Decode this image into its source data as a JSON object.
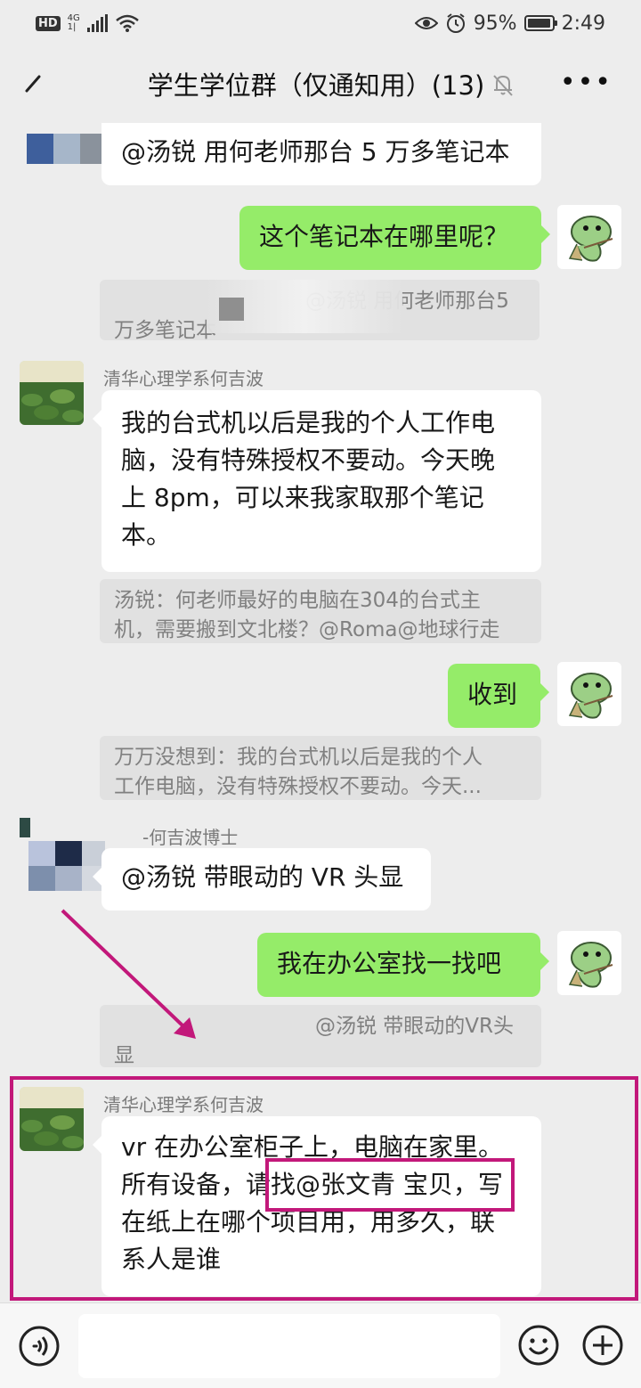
{
  "status_bar": {
    "hd": "HD",
    "network": "4G",
    "network_sub": "1|",
    "battery_pct_text": "95%",
    "battery_level": 0.95,
    "time": "2:49"
  },
  "header": {
    "back_icon": "back-arrow-icon",
    "title": "学生学位群（仅通知用）(13)",
    "mute_icon": "bell-muted-icon",
    "more_icon": "more-dots-icon"
  },
  "messages": [
    {
      "dir": "in",
      "text": "@汤锐 用何老师那台 5 万多笔记本"
    },
    {
      "dir": "out",
      "text": "这个笔记本在哪里呢？"
    },
    {
      "quote": "@汤锐 用何老师那台5万多笔记本",
      "quote_l1": "@汤锐 用何老师那台5",
      "quote_l2": "万多笔记本"
    },
    {
      "dir": "in",
      "sender": "清华心理学系何吉波",
      "lines": [
        "我的台式机以后是我的个人工作电",
        "脑，没有特殊授权不要动。今天晚",
        "上 8pm，可以来我家取那个笔记",
        "本。"
      ]
    },
    {
      "quote_l1": "汤锐：何老师最好的电脑在304的台式主",
      "quote_l2": "机，需要搬到文北楼？@Roma@地球行走"
    },
    {
      "dir": "out",
      "text": "收到"
    },
    {
      "quote_l1": "万万没想到：我的台式机以后是我的个人",
      "quote_l2": "工作电脑，没有特殊授权不要动。今天..."
    },
    {
      "dir": "in",
      "sender": "-何吉波博士",
      "text": "@汤锐 带眼动的 VR 头显"
    },
    {
      "dir": "out",
      "text": "我在办公室找一找吧"
    },
    {
      "quote_l1": "@汤锐 带眼动的VR头",
      "quote_l2": "显"
    },
    {
      "dir": "in",
      "sender": "清华心理学系何吉波",
      "lines": [
        "vr 在办公室柜子上，电脑在家里。",
        "所有设备，请找@张文青 宝贝，写",
        "在纸上在哪个项目用，用多久，联",
        "系人是谁"
      ]
    }
  ],
  "input_bar": {
    "voice_icon": "voice-icon",
    "emoji_icon": "emoji-icon",
    "plus_icon": "plus-icon"
  },
  "colors": {
    "background": "#ededed",
    "bubble_out": "#95ec69",
    "bubble_in": "#ffffff",
    "annotation": "#c2187a"
  }
}
